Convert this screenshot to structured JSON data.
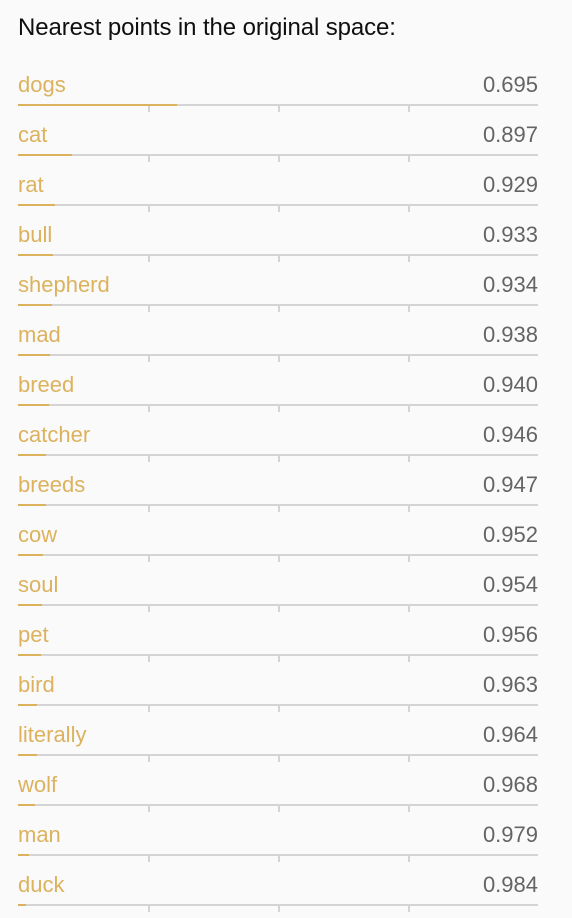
{
  "title": "Nearest points in the original space:",
  "accent_color": "#dcb25e",
  "items": [
    {
      "word": "dogs",
      "value": "0.695",
      "distance": 0.695
    },
    {
      "word": "cat",
      "value": "0.897",
      "distance": 0.897
    },
    {
      "word": "rat",
      "value": "0.929",
      "distance": 0.929
    },
    {
      "word": "bull",
      "value": "0.933",
      "distance": 0.933
    },
    {
      "word": "shepherd",
      "value": "0.934",
      "distance": 0.934
    },
    {
      "word": "mad",
      "value": "0.938",
      "distance": 0.938
    },
    {
      "word": "breed",
      "value": "0.940",
      "distance": 0.94
    },
    {
      "word": "catcher",
      "value": "0.946",
      "distance": 0.946
    },
    {
      "word": "breeds",
      "value": "0.947",
      "distance": 0.947
    },
    {
      "word": "cow",
      "value": "0.952",
      "distance": 0.952
    },
    {
      "word": "soul",
      "value": "0.954",
      "distance": 0.954
    },
    {
      "word": "pet",
      "value": "0.956",
      "distance": 0.956
    },
    {
      "word": "bird",
      "value": "0.963",
      "distance": 0.963
    },
    {
      "word": "literally",
      "value": "0.964",
      "distance": 0.964
    },
    {
      "word": "wolf",
      "value": "0.968",
      "distance": 0.968
    },
    {
      "word": "man",
      "value": "0.979",
      "distance": 0.979
    },
    {
      "word": "duck",
      "value": "0.984",
      "distance": 0.984
    }
  ]
}
